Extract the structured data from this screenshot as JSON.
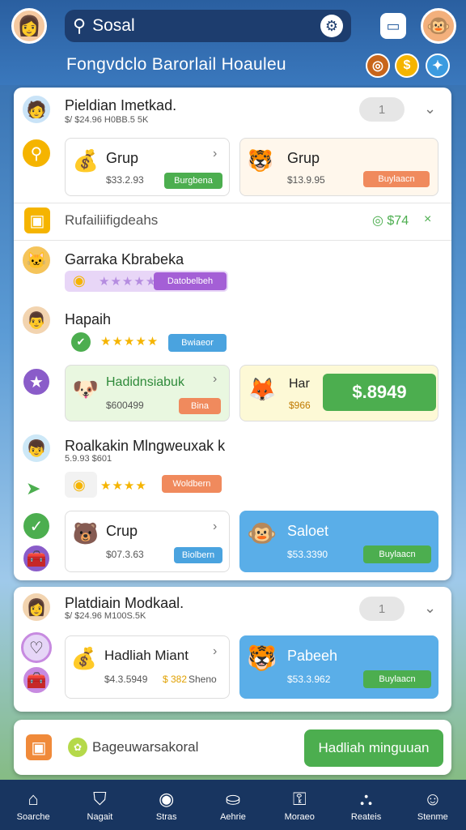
{
  "header": {
    "search_text": "Sosal",
    "subtitle": "Fongvdclo Barorlail Hoauleu"
  },
  "panel1": {
    "user_name": "Pieldian Imetkad.",
    "user_meta": "$/ $24.96 H0BB.5 5K",
    "toggle_value": "1",
    "card1": {
      "title": "Grup",
      "price": "$33.2.93",
      "button": "Burgbena"
    },
    "card2": {
      "title": "Grup",
      "price": "$13.9.95",
      "button": "Buylaacn"
    }
  },
  "section": {
    "label": "Rufailiifigdeahs",
    "amount": "$74",
    "close": "×"
  },
  "list": {
    "item1": {
      "name": "Garraka Kbrabeka",
      "button": "Datobelbeh"
    },
    "item2": {
      "name": "Hapaih",
      "button": "Bwiaeor"
    },
    "card_a": {
      "title": "Hadidnsiabuk",
      "price": "$600499",
      "button": "Bina"
    },
    "card_b": {
      "title": "Har",
      "price": "$966",
      "cta": "$.8949"
    },
    "item3": {
      "name": "Roalkakin Mlngweuxak k",
      "meta": "5.9.93 $601",
      "button": "Woldbern"
    },
    "card_c": {
      "title": "Crup",
      "price": "$07.3.63",
      "button": "Biolbern"
    },
    "card_d": {
      "title": "Saloet",
      "price": "$53.3390",
      "button": "Buylaacn"
    }
  },
  "panel2": {
    "user_name": "Platdiain Modkaal.",
    "user_meta": "$/ $24.96 M100S.5K",
    "toggle_value": "1",
    "card1": {
      "title": "Hadliah Miant",
      "price": "$4.3.5949",
      "price2": "$ 382",
      "extra": "Sheno"
    },
    "card2": {
      "title": "Pabeeh",
      "price": "$53.3.962",
      "button": "Buylaacn"
    }
  },
  "footer": {
    "label": "Bageuwarsakoral",
    "button": "Hadliah minguuan"
  },
  "nav": [
    {
      "label": "Soarche",
      "icon": "home-icon"
    },
    {
      "label": "Nagait",
      "icon": "bag-icon"
    },
    {
      "label": "Stras",
      "icon": "camera-icon"
    },
    {
      "label": "Aehrie",
      "icon": "basket-icon"
    },
    {
      "label": "Moraeo",
      "icon": "lock-icon"
    },
    {
      "label": "Reateis",
      "icon": "chart-icon"
    },
    {
      "label": "Stenme",
      "icon": "profile-icon"
    }
  ],
  "colors": {
    "accent": "#2a5fa0",
    "green": "#4cae4f",
    "orange": "#f08a5d",
    "blue": "#4aa3df"
  }
}
